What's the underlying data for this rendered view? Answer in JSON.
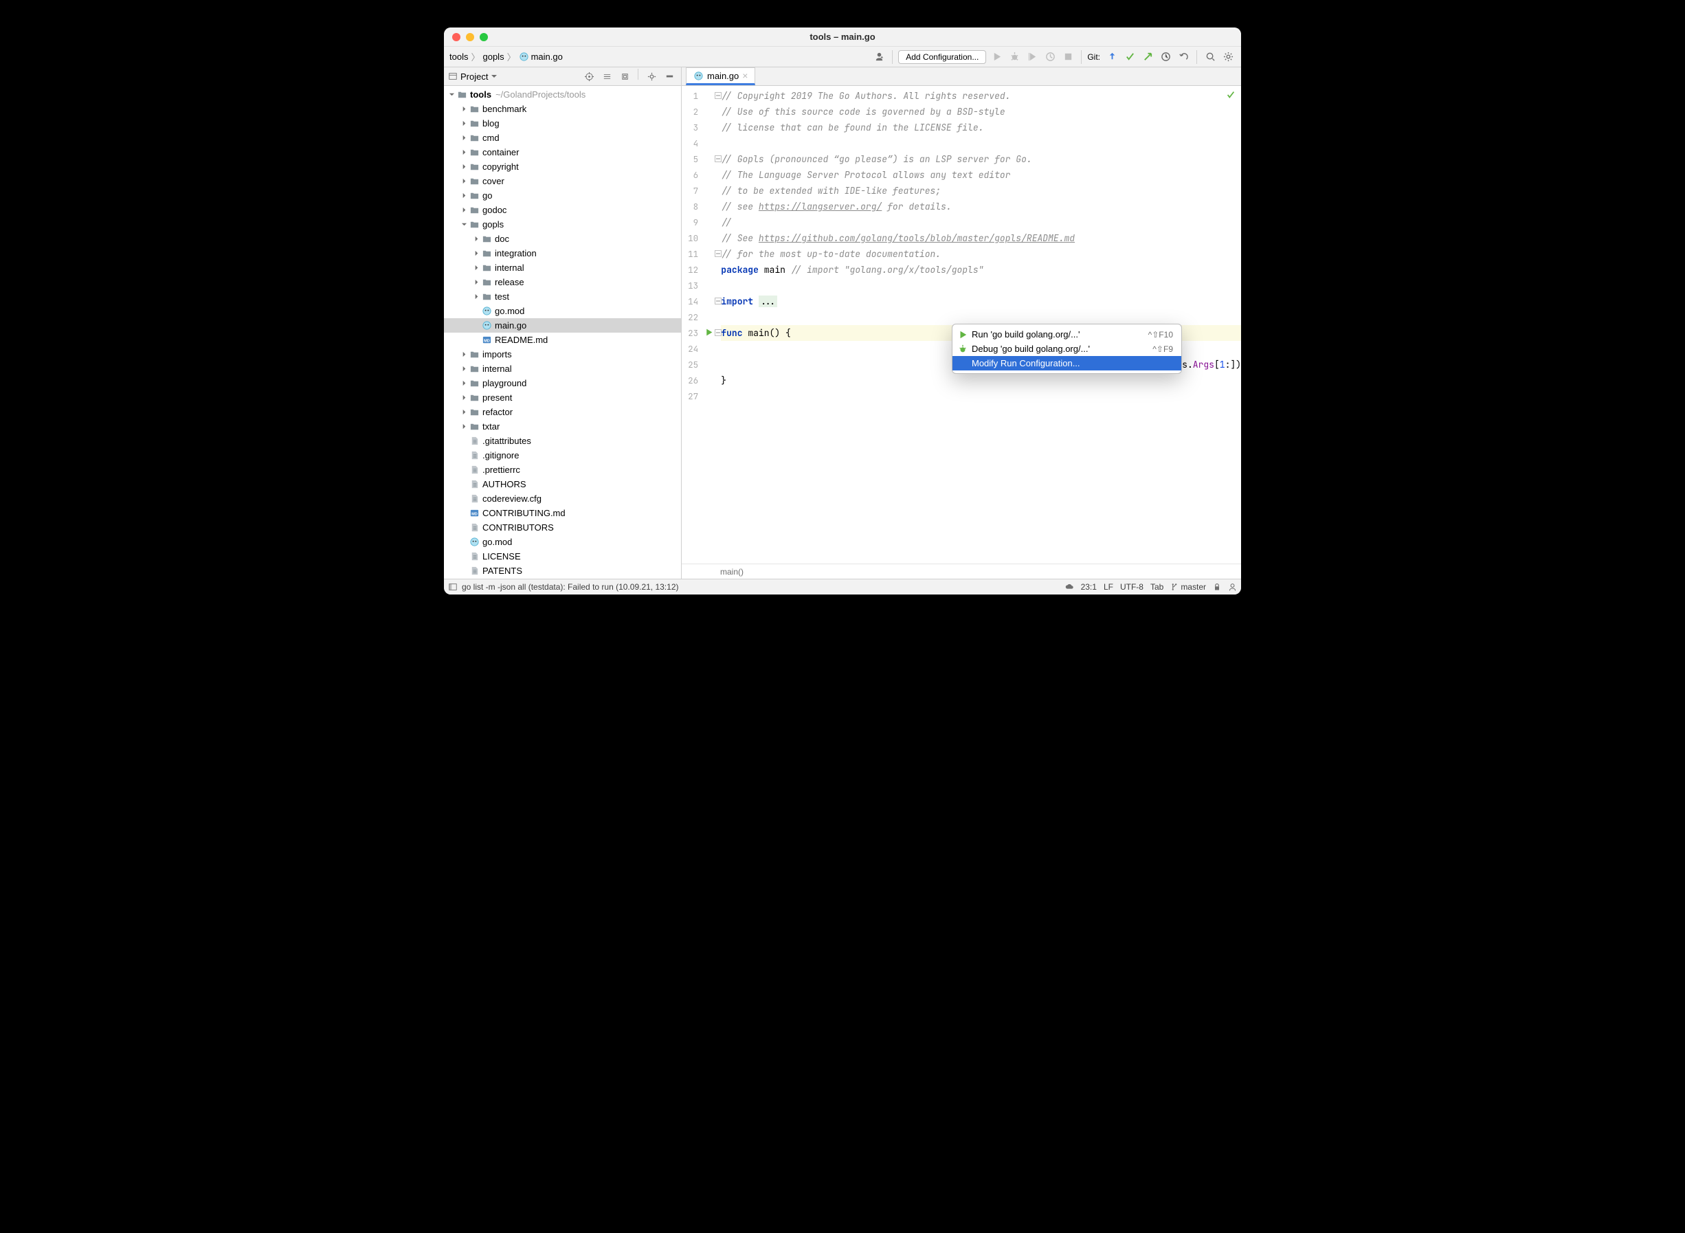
{
  "title": "tools – main.go",
  "breadcrumbs": [
    "tools",
    "gopls",
    "main.go"
  ],
  "toolbar": {
    "config": "Add Configuration...",
    "git_label": "Git:"
  },
  "sidebar": {
    "header": "Project",
    "root": {
      "name": "tools",
      "hint": "~/GolandProjects/tools"
    },
    "items": [
      {
        "type": "dir",
        "depth": 1,
        "name": "benchmark"
      },
      {
        "type": "dir",
        "depth": 1,
        "name": "blog"
      },
      {
        "type": "dir",
        "depth": 1,
        "name": "cmd"
      },
      {
        "type": "dir",
        "depth": 1,
        "name": "container"
      },
      {
        "type": "dir",
        "depth": 1,
        "name": "copyright"
      },
      {
        "type": "dir",
        "depth": 1,
        "name": "cover"
      },
      {
        "type": "dir",
        "depth": 1,
        "name": "go"
      },
      {
        "type": "dir",
        "depth": 1,
        "name": "godoc"
      },
      {
        "type": "dir",
        "depth": 1,
        "name": "gopls",
        "expanded": true
      },
      {
        "type": "dir",
        "depth": 2,
        "name": "doc"
      },
      {
        "type": "dir",
        "depth": 2,
        "name": "integration"
      },
      {
        "type": "dir",
        "depth": 2,
        "name": "internal"
      },
      {
        "type": "dir",
        "depth": 2,
        "name": "release"
      },
      {
        "type": "dir",
        "depth": 2,
        "name": "test"
      },
      {
        "type": "go",
        "depth": 2,
        "name": "go.mod",
        "leaf": true
      },
      {
        "type": "go",
        "depth": 2,
        "name": "main.go",
        "leaf": true,
        "selected": true
      },
      {
        "type": "md",
        "depth": 2,
        "name": "README.md",
        "leaf": true
      },
      {
        "type": "dir",
        "depth": 1,
        "name": "imports"
      },
      {
        "type": "dir",
        "depth": 1,
        "name": "internal"
      },
      {
        "type": "dir",
        "depth": 1,
        "name": "playground"
      },
      {
        "type": "dir",
        "depth": 1,
        "name": "present"
      },
      {
        "type": "dir",
        "depth": 1,
        "name": "refactor"
      },
      {
        "type": "dir",
        "depth": 1,
        "name": "txtar"
      },
      {
        "type": "txt",
        "depth": 1,
        "name": ".gitattributes",
        "leaf": true
      },
      {
        "type": "txt",
        "depth": 1,
        "name": ".gitignore",
        "leaf": true
      },
      {
        "type": "txt",
        "depth": 1,
        "name": ".prettierrc",
        "leaf": true
      },
      {
        "type": "txt",
        "depth": 1,
        "name": "AUTHORS",
        "leaf": true
      },
      {
        "type": "txt",
        "depth": 1,
        "name": "codereview.cfg",
        "leaf": true
      },
      {
        "type": "md",
        "depth": 1,
        "name": "CONTRIBUTING.md",
        "leaf": true
      },
      {
        "type": "txt",
        "depth": 1,
        "name": "CONTRIBUTORS",
        "leaf": true
      },
      {
        "type": "go",
        "depth": 1,
        "name": "go.mod",
        "leaf": true
      },
      {
        "type": "txt",
        "depth": 1,
        "name": "LICENSE",
        "leaf": true
      },
      {
        "type": "txt",
        "depth": 1,
        "name": "PATENTS",
        "leaf": true
      }
    ]
  },
  "tab": {
    "name": "main.go"
  },
  "gutter_lines": [
    "1",
    "2",
    "3",
    "4",
    "5",
    "6",
    "7",
    "8",
    "9",
    "10",
    "11",
    "12",
    "13",
    "14",
    "22",
    "23",
    "24",
    "25",
    "26",
    "27"
  ],
  "code_lines": [
    {
      "html": "<span class='cm'>// Copyright 2019 The Go Authors. All rights reserved.</span>"
    },
    {
      "html": "<span class='cm'>// Use of this source code is governed by a BSD-style</span>"
    },
    {
      "html": "<span class='cm'>// license that can be found in the LICENSE file.</span>"
    },
    {
      "html": ""
    },
    {
      "html": "<span class='cm'>// Gopls (pronounced “go please”) is an LSP server for Go.</span>"
    },
    {
      "html": "<span class='cm'>// The Language Server Protocol allows any text editor</span>"
    },
    {
      "html": "<span class='cm'>// to be extended with IDE-like features;</span>"
    },
    {
      "html": "<span class='cm'>// see <span class='lnk'>https://langserver.org/</span> for details.</span>"
    },
    {
      "html": "<span class='cm'>//</span>"
    },
    {
      "html": "<span class='cm'>// See <span class='lnk'>https://github.com/golang/tools/blob/master/gopls/README.md</span></span>"
    },
    {
      "html": "<span class='cm'>// for the most up-to-date documentation.</span>"
    },
    {
      "html": "<span class='kw'>package</span> <span class='pkg'>main</span> <span class='cm'>// import \"golang.org/x/tools/gopls\"</span>"
    },
    {
      "html": ""
    },
    {
      "html": "<span class='kw'>import</span> <span class='bg-dots'>...</span>"
    },
    {
      "html": ""
    },
    {
      "html": "<span class='kw'>func</span> <span class='id'>main</span>() {",
      "cur": true
    },
    {
      "html": ""
    },
    {
      "html": "                                            <span class='str'>ls\"</span>,  wd: <span class='str'>\"\"</span>,  env: <span class='kw'>nil</span>, hooks.<span class='prop'>Options</span>), os.<span class='prop'>Args</span>[<span class='num'>1</span>:])"
    },
    {
      "html": "}"
    },
    {
      "html": ""
    }
  ],
  "context_menu": {
    "items": [
      {
        "icon": "run",
        "label": "Run 'go build golang.org/...'",
        "shortcut": "^⇧F10"
      },
      {
        "icon": "debug",
        "label": "Debug 'go build golang.org/...'",
        "shortcut": "^⇧F9"
      },
      {
        "icon": "",
        "label": "Modify Run Configuration...",
        "shortcut": "",
        "selected": true
      }
    ]
  },
  "crumb_bar": "main()",
  "status": {
    "left": "go list -m -json all (testdata): Failed to run (10.09.21, 13:12)",
    "right": {
      "pos": "23:1",
      "sep": "LF",
      "enc": "UTF-8",
      "indent": "Tab",
      "branch": "master"
    }
  }
}
